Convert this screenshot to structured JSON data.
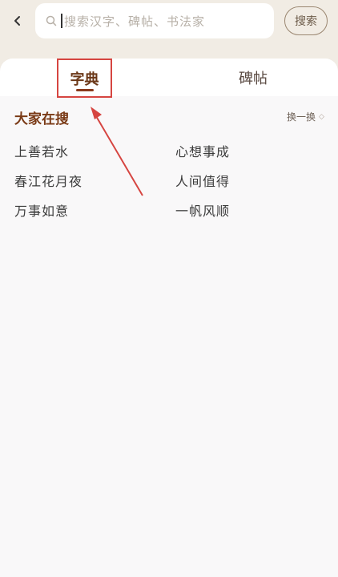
{
  "search": {
    "placeholder": "搜索汉字、碑帖、书法家",
    "button_label": "搜索"
  },
  "tabs": [
    {
      "label": "字典",
      "active": true
    },
    {
      "label": "碑帖",
      "active": false
    }
  ],
  "trending": {
    "title": "大家在搜",
    "refresh_label": "换一换",
    "items": [
      "上善若水",
      "心想事成",
      "春江花月夜",
      "人间值得",
      "万事如意",
      "一帆风顺"
    ]
  },
  "colors": {
    "background": "#f1ece4",
    "accent_brown": "#7a3a16",
    "annotation_red": "#d64541"
  },
  "icons": [
    "back-icon",
    "search-icon",
    "refresh-icon"
  ]
}
